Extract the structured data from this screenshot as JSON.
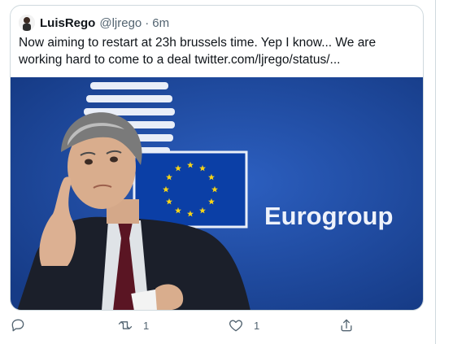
{
  "tweet": {
    "author_name": "LuisRego",
    "handle": "@ljrego",
    "separator": "·",
    "time": "6m",
    "text": "Now aiming to restart at 23h brussels time. Yep I know... We are working hard to come to a deal twitter.com/ljrego/status/..."
  },
  "media": {
    "sign_text": "Eurogroup",
    "background_color": "#1f4ea3",
    "flag_color": "#0a3fa8",
    "star_color": "#f7d417"
  },
  "actions": {
    "reply_icon": "reply-icon",
    "retweet_icon": "retweet-icon",
    "retweet_count": "1",
    "like_icon": "heart-icon",
    "like_count": "1",
    "share_icon": "share-icon"
  },
  "colors": {
    "secondary_text": "#536471",
    "border": "#cfd9de"
  }
}
